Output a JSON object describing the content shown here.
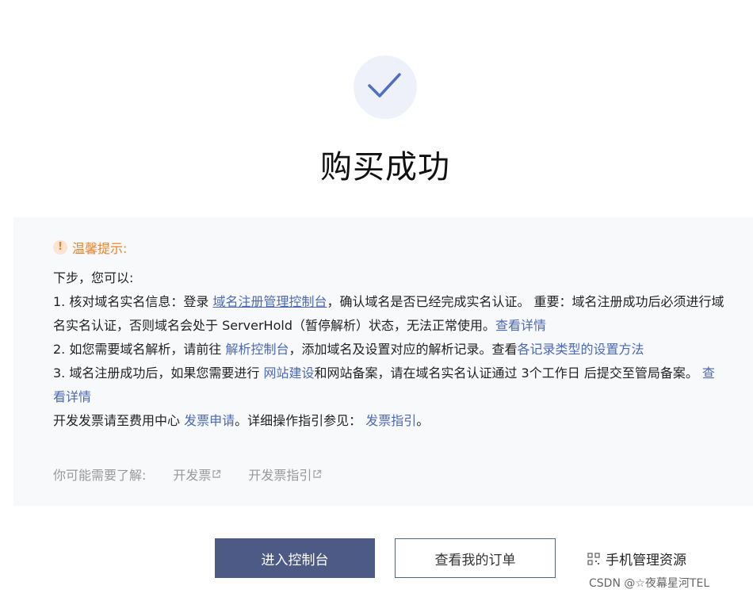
{
  "header": {
    "title": "购买成功"
  },
  "tips": {
    "heading": "温馨提示:",
    "intro": "下步，您可以:",
    "item1": {
      "prefix": "1. 核对域名实名信息：登录 ",
      "link": "域名注册管理控制台",
      "middle": "，确认域名是否已经完成实名认证。 重要：域名注册成功后必须进行域名实名认证，否则域名会处于 ServerHold（暂停解析）状态，无法正常使用。",
      "detail_link": "查看详情"
    },
    "item2": {
      "prefix": "2. 如您需要域名解析，请前往 ",
      "link": "解析控制台",
      "middle": "，添加域名及设置对应的解析记录。查看",
      "link2": "各记录类型的设置方法"
    },
    "item3": {
      "prefix": "3. 域名注册成功后，如果您需要进行 ",
      "link": "网站建设",
      "middle": "和网站备案，请在域名实名认证通过 3个工作日 后提交至管局备案。 ",
      "detail_link": "查看详情"
    },
    "invoice": {
      "prefix": "开发发票请至费用中心 ",
      "link": "发票申请",
      "middle": "。详细操作指引参见：  ",
      "link2": "发票指引",
      "suffix": "。"
    }
  },
  "may_need": {
    "label": "你可能需要了解:",
    "links": [
      "开发票",
      "开发票指引"
    ]
  },
  "actions": {
    "primary": "进入控制台",
    "secondary": "查看我的订单",
    "mobile": "手机管理资源"
  },
  "watermark": "CSDN @☆夜幕星河TEL",
  "colors": {
    "accent": "#4a68b5",
    "warning": "#e7822a",
    "primary_button": "#4e5a86"
  }
}
